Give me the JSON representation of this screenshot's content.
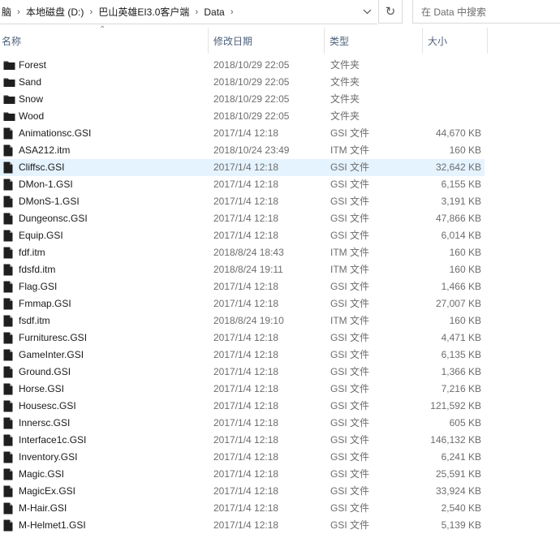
{
  "address": {
    "crumbs": [
      "脑",
      "本地磁盘 (D:)",
      "巴山英雄EI3.0客户端",
      "Data"
    ]
  },
  "search": {
    "placeholder": "在 Data 中搜索"
  },
  "columns": {
    "name": "名称",
    "date": "修改日期",
    "type": "类型",
    "size": "大小"
  },
  "files": [
    {
      "name": "Forest",
      "date": "2018/10/29 22:05",
      "type": "文件夹",
      "size": "",
      "icon": "folder-icon",
      "selected": false
    },
    {
      "name": "Sand",
      "date": "2018/10/29 22:05",
      "type": "文件夹",
      "size": "",
      "icon": "folder-icon",
      "selected": false
    },
    {
      "name": "Snow",
      "date": "2018/10/29 22:05",
      "type": "文件夹",
      "size": "",
      "icon": "folder-icon",
      "selected": false
    },
    {
      "name": "Wood",
      "date": "2018/10/29 22:05",
      "type": "文件夹",
      "size": "",
      "icon": "folder-icon",
      "selected": false
    },
    {
      "name": "Animationsc.GSI",
      "date": "2017/1/4 12:18",
      "type": "GSI 文件",
      "size": "44,670 KB",
      "icon": "file-icon",
      "selected": false
    },
    {
      "name": "ASA212.itm",
      "date": "2018/10/24 23:49",
      "type": "ITM 文件",
      "size": "160 KB",
      "icon": "file-icon",
      "selected": false
    },
    {
      "name": "Cliffsc.GSI",
      "date": "2017/1/4 12:18",
      "type": "GSI 文件",
      "size": "32,642 KB",
      "icon": "file-icon",
      "selected": true
    },
    {
      "name": "DMon-1.GSI",
      "date": "2017/1/4 12:18",
      "type": "GSI 文件",
      "size": "6,155 KB",
      "icon": "file-icon",
      "selected": false
    },
    {
      "name": "DMonS-1.GSI",
      "date": "2017/1/4 12:18",
      "type": "GSI 文件",
      "size": "3,191 KB",
      "icon": "file-icon",
      "selected": false
    },
    {
      "name": "Dungeonsc.GSI",
      "date": "2017/1/4 12:18",
      "type": "GSI 文件",
      "size": "47,866 KB",
      "icon": "file-icon",
      "selected": false
    },
    {
      "name": "Equip.GSI",
      "date": "2017/1/4 12:18",
      "type": "GSI 文件",
      "size": "6,014 KB",
      "icon": "file-icon",
      "selected": false
    },
    {
      "name": "fdf.itm",
      "date": "2018/8/24 18:43",
      "type": "ITM 文件",
      "size": "160 KB",
      "icon": "file-icon",
      "selected": false
    },
    {
      "name": "fdsfd.itm",
      "date": "2018/8/24 19:11",
      "type": "ITM 文件",
      "size": "160 KB",
      "icon": "file-icon",
      "selected": false
    },
    {
      "name": "Flag.GSI",
      "date": "2017/1/4 12:18",
      "type": "GSI 文件",
      "size": "1,466 KB",
      "icon": "file-icon",
      "selected": false
    },
    {
      "name": "Fmmap.GSI",
      "date": "2017/1/4 12:18",
      "type": "GSI 文件",
      "size": "27,007 KB",
      "icon": "file-icon",
      "selected": false
    },
    {
      "name": "fsdf.itm",
      "date": "2018/8/24 19:10",
      "type": "ITM 文件",
      "size": "160 KB",
      "icon": "file-icon",
      "selected": false
    },
    {
      "name": "Furnituresc.GSI",
      "date": "2017/1/4 12:18",
      "type": "GSI 文件",
      "size": "4,471 KB",
      "icon": "file-icon",
      "selected": false
    },
    {
      "name": "GameInter.GSI",
      "date": "2017/1/4 12:18",
      "type": "GSI 文件",
      "size": "6,135 KB",
      "icon": "file-icon",
      "selected": false
    },
    {
      "name": "Ground.GSI",
      "date": "2017/1/4 12:18",
      "type": "GSI 文件",
      "size": "1,366 KB",
      "icon": "file-icon",
      "selected": false
    },
    {
      "name": "Horse.GSI",
      "date": "2017/1/4 12:18",
      "type": "GSI 文件",
      "size": "7,216 KB",
      "icon": "file-icon",
      "selected": false
    },
    {
      "name": "Housesc.GSI",
      "date": "2017/1/4 12:18",
      "type": "GSI 文件",
      "size": "121,592 KB",
      "icon": "file-icon",
      "selected": false
    },
    {
      "name": "Innersc.GSI",
      "date": "2017/1/4 12:18",
      "type": "GSI 文件",
      "size": "605 KB",
      "icon": "file-icon",
      "selected": false
    },
    {
      "name": "Interface1c.GSI",
      "date": "2017/1/4 12:18",
      "type": "GSI 文件",
      "size": "146,132 KB",
      "icon": "file-icon",
      "selected": false
    },
    {
      "name": "Inventory.GSI",
      "date": "2017/1/4 12:18",
      "type": "GSI 文件",
      "size": "6,241 KB",
      "icon": "file-icon",
      "selected": false
    },
    {
      "name": "Magic.GSI",
      "date": "2017/1/4 12:18",
      "type": "GSI 文件",
      "size": "25,591 KB",
      "icon": "file-icon",
      "selected": false
    },
    {
      "name": "MagicEx.GSI",
      "date": "2017/1/4 12:18",
      "type": "GSI 文件",
      "size": "33,924 KB",
      "icon": "file-icon",
      "selected": false
    },
    {
      "name": "M-Hair.GSI",
      "date": "2017/1/4 12:18",
      "type": "GSI 文件",
      "size": "2,540 KB",
      "icon": "file-icon",
      "selected": false
    },
    {
      "name": "M-Helmet1.GSI",
      "date": "2017/1/4 12:18",
      "type": "GSI 文件",
      "size": "5,139 KB",
      "icon": "file-icon",
      "selected": false
    }
  ]
}
